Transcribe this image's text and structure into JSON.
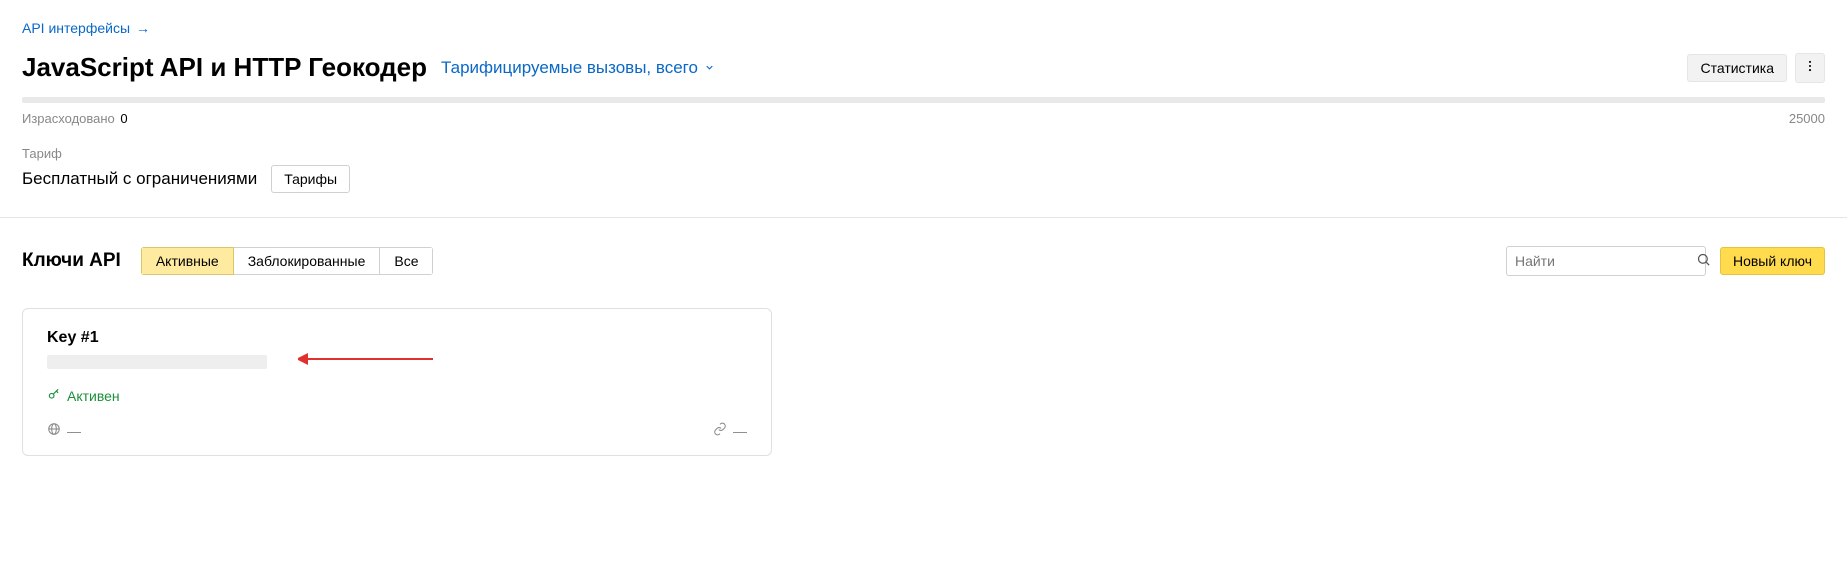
{
  "breadcrumb": {
    "label": "API интерфейсы"
  },
  "header": {
    "title": "JavaScript API и HTTP Геокодер",
    "subtitle": "Тарифицируемые вызовы, всего",
    "stats_button": "Статистика"
  },
  "usage": {
    "spent_label": "Израсходовано",
    "spent_value": "0",
    "limit": "25000"
  },
  "tariff": {
    "label": "Тариф",
    "value": "Бесплатный с ограничениями",
    "button": "Тарифы"
  },
  "keys": {
    "title": "Ключи API",
    "tabs": {
      "active": "Активные",
      "blocked": "Заблокированные",
      "all": "Все"
    },
    "search_placeholder": "Найти",
    "new_key_button": "Новый ключ"
  },
  "key_card": {
    "name": "Key #1",
    "status": "Активен",
    "globe_value": "—",
    "link_value": "—"
  }
}
